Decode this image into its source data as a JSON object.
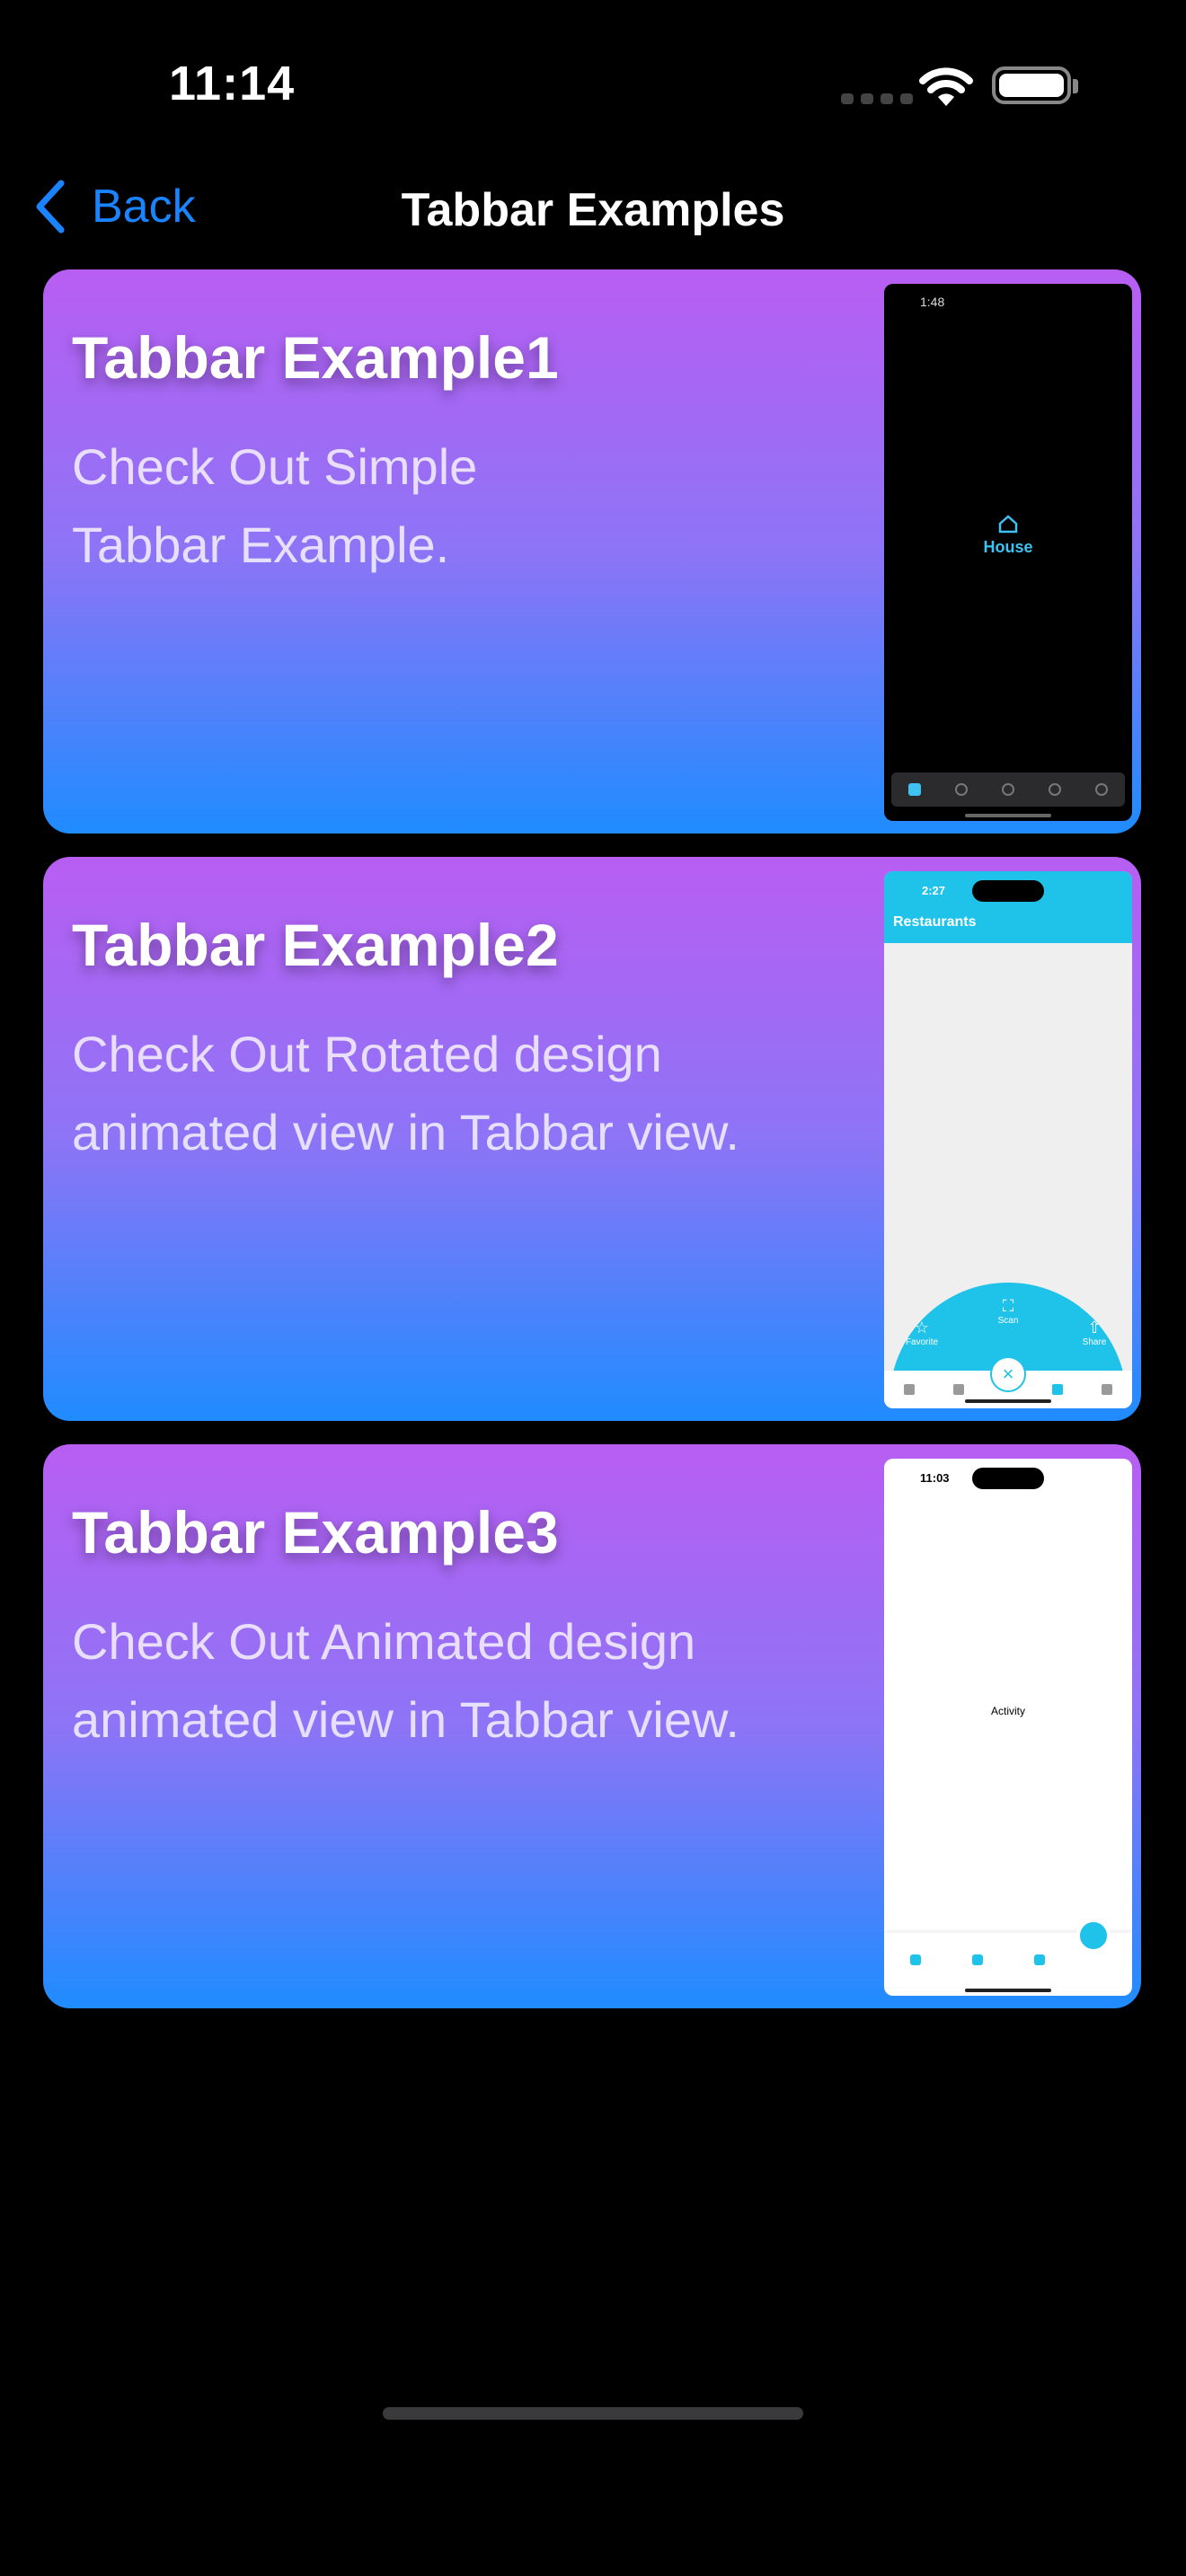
{
  "status_bar": {
    "time": "11:14"
  },
  "nav": {
    "back_label": "Back",
    "title": "Tabbar Examples"
  },
  "colors": {
    "accent": "#1a84ff",
    "card_gradient_top": "#b85ef2",
    "card_gradient_bottom": "#1f8cff",
    "thumb_accent": "#1fc2e8"
  },
  "cards": [
    {
      "title": "Tabbar Example1",
      "description": "Check Out Simple Tabbar Example.",
      "thumb": {
        "time": "1:48",
        "center_label": "House"
      }
    },
    {
      "title": "Tabbar Example2",
      "description": "Check Out Rotated design animated view in Tabbar view.",
      "thumb": {
        "time": "2:27",
        "header": "Restaurants",
        "actions": [
          "Favorite",
          "Scan",
          "Share"
        ]
      }
    },
    {
      "title": "Tabbar Example3",
      "description": "Check Out Animated design animated view in Tabbar view.",
      "thumb": {
        "time": "11:03",
        "center_label": "Activity"
      }
    }
  ]
}
